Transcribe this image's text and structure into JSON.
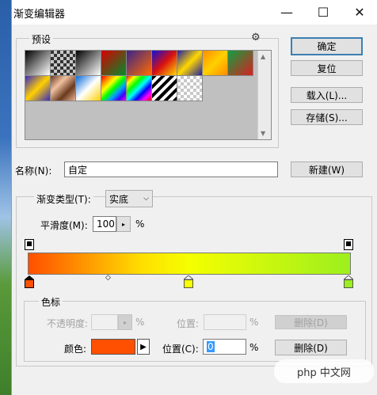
{
  "window": {
    "title": "渐变编辑器",
    "minimize": "—",
    "maximize": "☐",
    "close": "✕"
  },
  "presets": {
    "legend": "预设",
    "gear": "⚙",
    "swatches": [
      "linear-gradient(135deg,#000,#fff)",
      "checker-fade",
      "linear-gradient(135deg,#000,#fff)",
      "linear-gradient(135deg,#d80000,#008c2c)",
      "linear-gradient(135deg,#3b2389,#ff6a00)",
      "linear-gradient(135deg,#1010d8,#d81010,#ffd800)",
      "linear-gradient(135deg,#2020a0,#ffd800,#2020a0)",
      "linear-gradient(135deg,#ff8c00,#ffd000,#ff8c00)",
      "linear-gradient(135deg,#10a040,#d82020)",
      "linear-gradient(135deg,#3a2ac0,#ffd000,#3a2ac0)",
      "linear-gradient(135deg,#6a3a20,#f0c0a0,#6a3a20,#e8b090)",
      "linear-gradient(135deg,#0a6ad8,#ffffff,#ffd000)",
      "linear-gradient(135deg,#ff0000,#ff8000,#ffff00,#00ff00,#00a0ff,#4000ff,#ff00ff)",
      "linear-gradient(135deg,#ff0000,#ffff00,#00ff00,#00ffff,#0000ff,#ff00ff,#ff0000)",
      "repeating-linear-gradient(135deg,#000 0 4px,#fff 4px 8px)",
      "checker"
    ]
  },
  "buttons": {
    "ok": "确定",
    "reset": "复位",
    "load": "载入(L)...",
    "save": "存储(S)...",
    "new": "新建(W)",
    "delete_opacity": "删除(D)",
    "delete_color": "删除(D)"
  },
  "name_field": {
    "label": "名称(N):",
    "value": "自定"
  },
  "gradient_type": {
    "label": "渐变类型(T):",
    "value": "实底"
  },
  "smoothness": {
    "label": "平滑度(M):",
    "value": "100",
    "unit": "%"
  },
  "gradient": {
    "colors": [
      "#ff4f00",
      "#ffde00",
      "#f5ff00",
      "#9cef1e"
    ]
  },
  "stops": {
    "legend": "色标",
    "opacity_label": "不透明度:",
    "opacity_unit": "%",
    "opacity_position_label": "位置:",
    "opacity_position_unit": "%",
    "color_label": "颜色:",
    "color_value": "#ff4f00",
    "color_position_label": "位置(C):",
    "color_position_value": "0",
    "color_position_unit": "%"
  },
  "watermark": {
    "text": "php 中文网"
  }
}
